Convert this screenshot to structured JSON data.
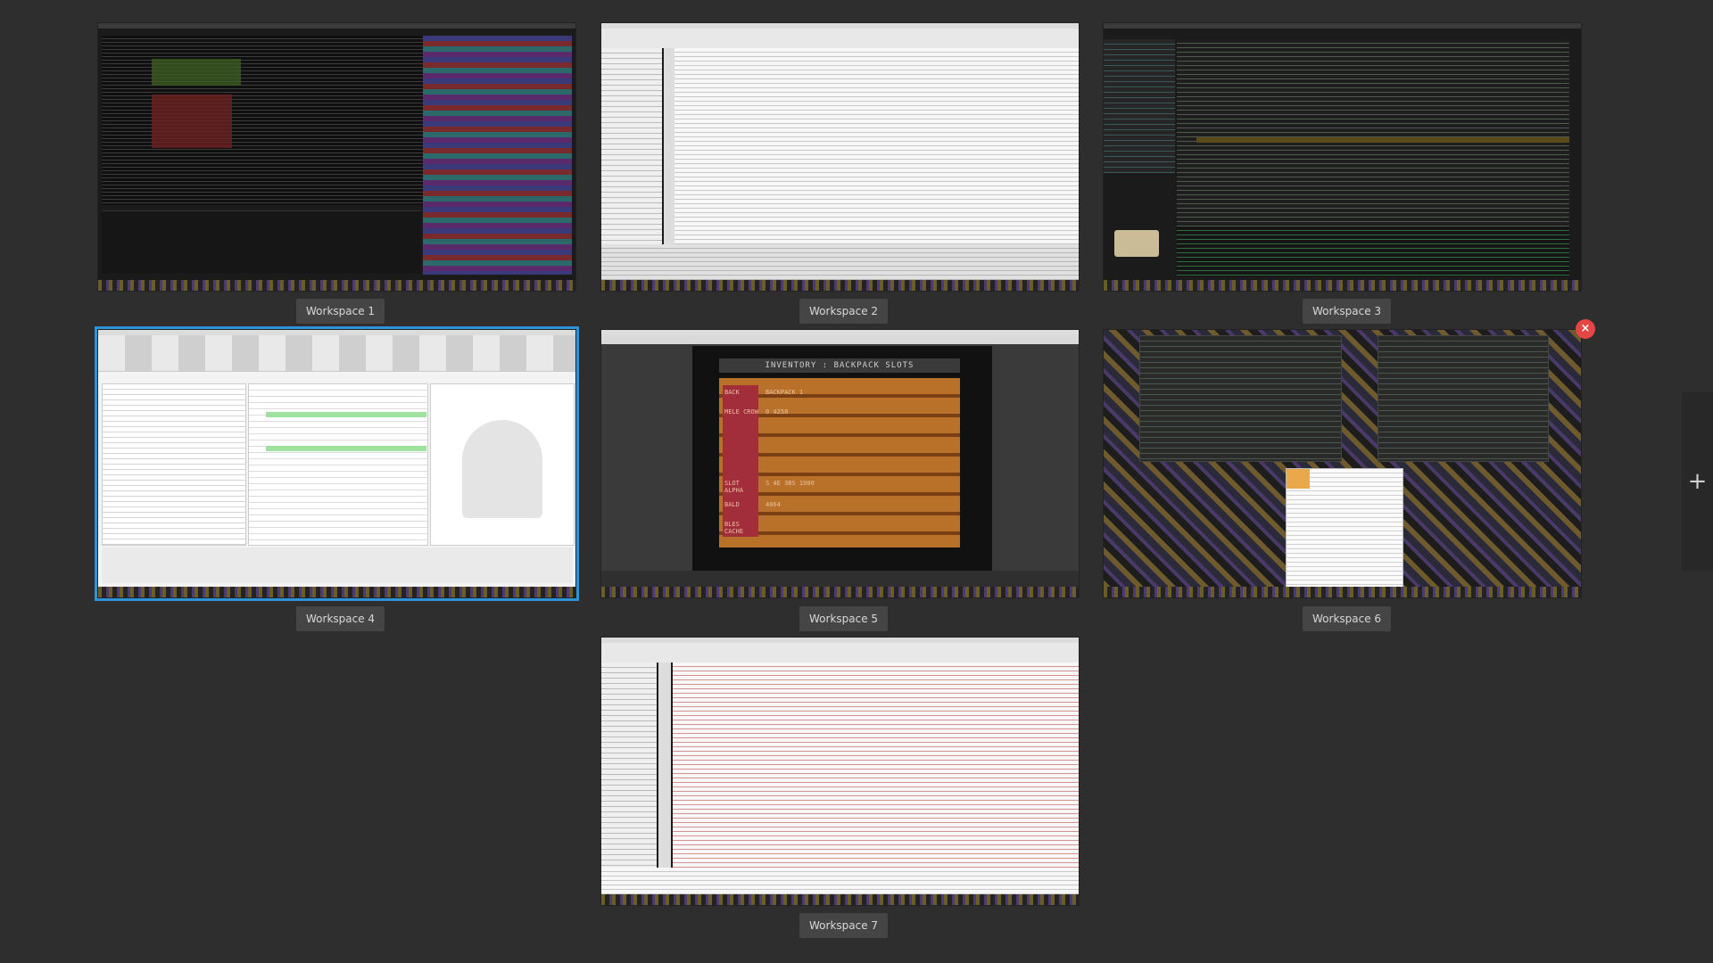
{
  "workspaces": [
    {
      "label": "Workspace 1"
    },
    {
      "label": "Workspace 2"
    },
    {
      "label": "Workspace 3"
    },
    {
      "label": "Workspace 4"
    },
    {
      "label": "Workspace 5"
    },
    {
      "label": "Workspace 6"
    },
    {
      "label": "Workspace 7"
    }
  ],
  "active_workspace": "Workspace 4",
  "ws5_game": {
    "banner": "INVENTORY : BACKPACK SLOTS",
    "rows": [
      "BACK",
      "MELE CROW",
      "SLOT ALPHA",
      "BALD",
      "BLES CACHE"
    ],
    "values": [
      "BACKPACK 1",
      "0 4258",
      "S 4E 3BS 1000",
      "4064"
    ]
  },
  "controls": {
    "close_glyph": "×",
    "add_glyph": "+"
  },
  "colors": {
    "background": "#2e2e2e",
    "accent": "#2c93d8",
    "close": "#e64545"
  },
  "icons": [
    "close-icon",
    "plus-icon",
    "person-silhouette-icon",
    "folder-icon",
    "computer-icon"
  ]
}
